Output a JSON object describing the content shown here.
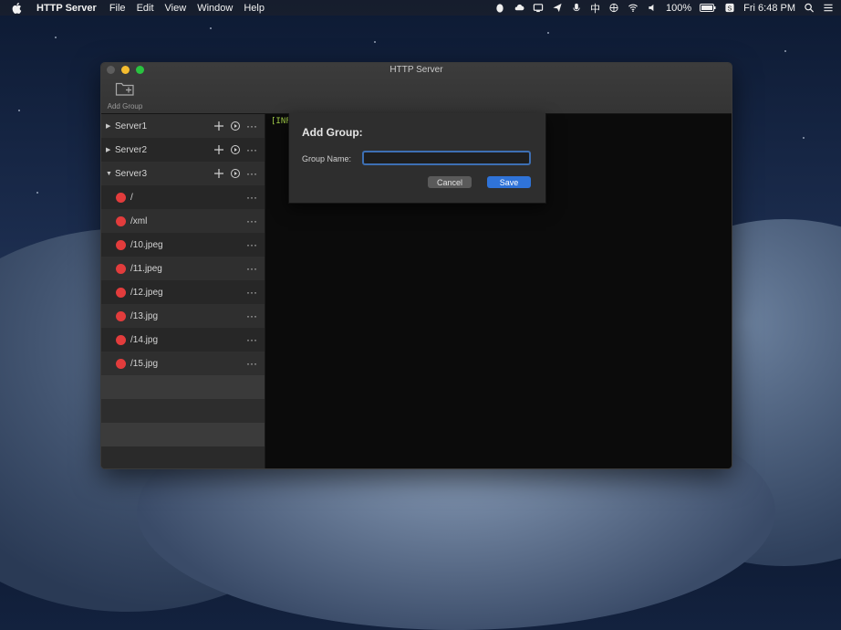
{
  "menubar": {
    "app_name": "HTTP Server",
    "menus": [
      "File",
      "Edit",
      "View",
      "Window",
      "Help"
    ],
    "battery": "100%",
    "ime": "中",
    "clock": "Fri 6:48 PM"
  },
  "window": {
    "title": "HTTP Server",
    "toolbar": {
      "add_group_label": "Add Group"
    }
  },
  "sidebar": {
    "servers": [
      {
        "label": "Server1",
        "expanded": false
      },
      {
        "label": "Server2",
        "expanded": false
      },
      {
        "label": "Server3",
        "expanded": true
      }
    ],
    "routes": [
      "/",
      "/xml",
      "/10.jpeg",
      "/11.jpeg",
      "/12.jpeg",
      "/13.jpg",
      "/14.jpg",
      "/15.jpg"
    ],
    "route_status_color": "#e23c3c"
  },
  "console": {
    "line": "[INF("
  },
  "dialog": {
    "title": "Add Group:",
    "field_label": "Group Name:",
    "field_value": "",
    "cancel_label": "Cancel",
    "save_label": "Save"
  },
  "colors": {
    "accent": "#2f73d8",
    "console_text": "#a6d24a"
  }
}
